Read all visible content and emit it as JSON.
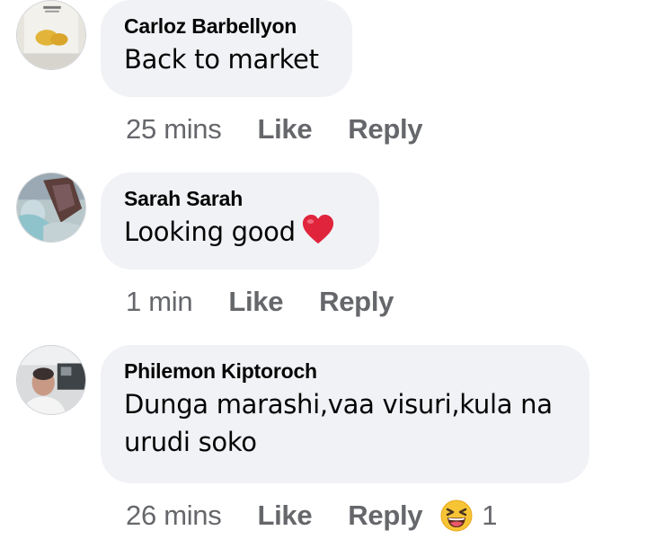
{
  "comments": [
    {
      "author": "Carloz Barbellyon",
      "text": "Back to market",
      "time": "25 mins",
      "like_label": "Like",
      "reply_label": "Reply"
    },
    {
      "author": "Sarah Sarah",
      "text": "Looking good",
      "emoji": "heart-icon",
      "time": "1 min",
      "like_label": "Like",
      "reply_label": "Reply"
    },
    {
      "author": "Philemon Kiptoroch",
      "text_line1": "Dunga marashi,vaa visuri,kula na",
      "text_line2": "urudi soko",
      "time": "26 mins",
      "like_label": "Like",
      "reply_label": "Reply",
      "reaction": "laughing-emoji-icon",
      "reaction_count": "1"
    }
  ],
  "colors": {
    "bubble": "#f0f2f5",
    "meta_text": "#65676b",
    "heart": "#e0243c"
  }
}
